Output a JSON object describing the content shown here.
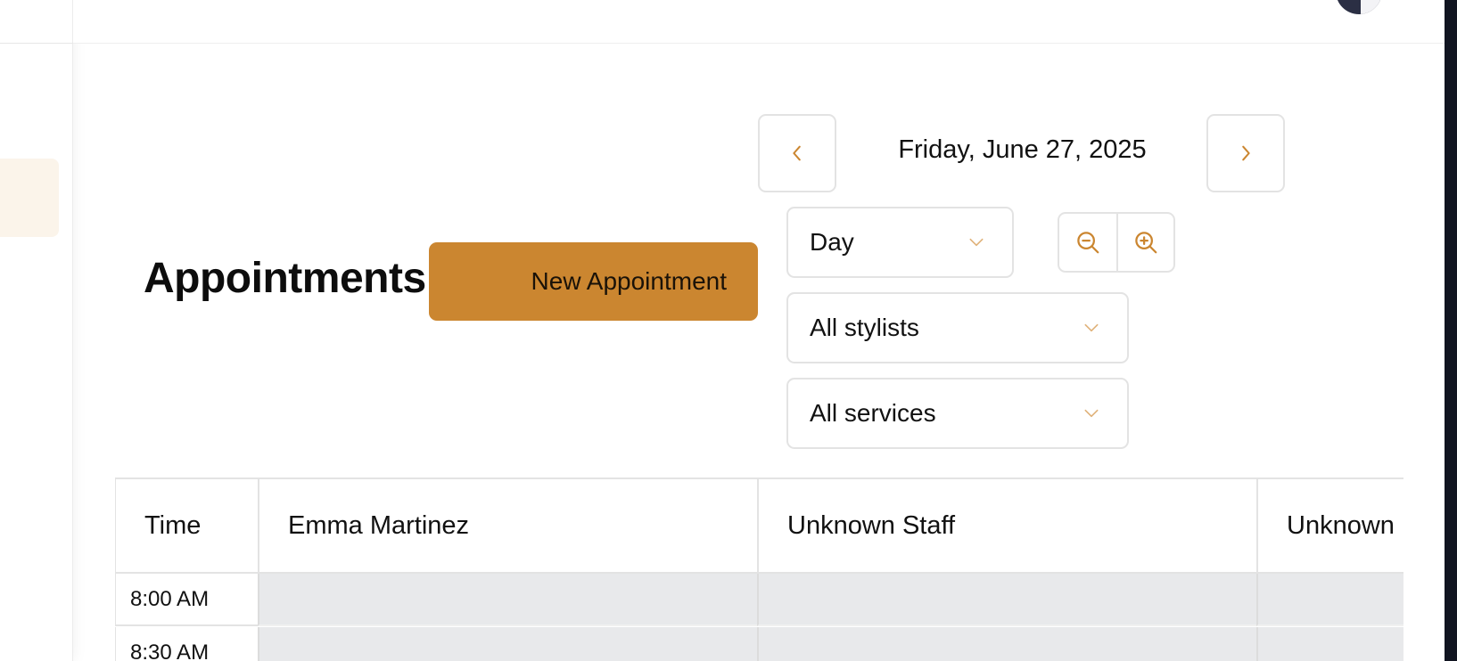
{
  "page": {
    "title": "Appointments",
    "new_appointment_label": "New Appointment"
  },
  "date_nav": {
    "current_date": "Friday, June 27, 2025",
    "prev_icon": "chevron-left-icon",
    "next_icon": "chevron-right-icon"
  },
  "filters": {
    "view": "Day",
    "stylist": "All stylists",
    "service": "All services"
  },
  "zoom": {
    "zoom_out_icon": "zoom-out-icon",
    "zoom_in_icon": "zoom-in-icon"
  },
  "schedule": {
    "time_header": "Time",
    "staff": [
      "Emma Martinez",
      "Unknown Staff",
      "Unknown"
    ],
    "slots": [
      "8:00 AM",
      "8:30 AM"
    ]
  },
  "colors": {
    "accent": "#cb8630",
    "slot_busy": "#e8e9eb",
    "sidebar_active": "#fbf4ea"
  }
}
